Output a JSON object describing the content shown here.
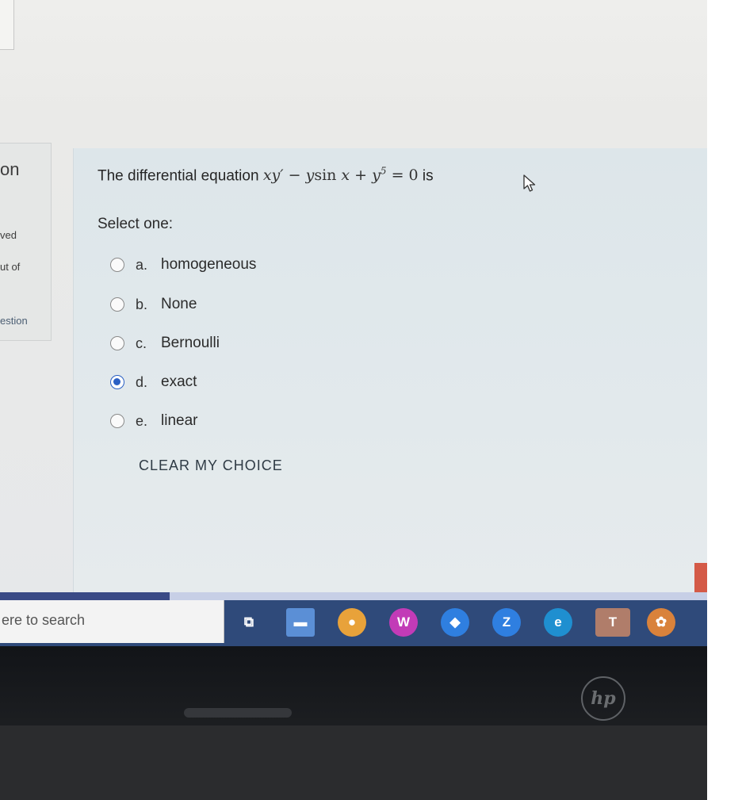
{
  "sidebar": {
    "title": "on",
    "line1": "ved",
    "line2": "ut of",
    "line3": "estion"
  },
  "question": {
    "prefix": "The differential equation",
    "eq": {
      "p1": "xy′ − y",
      "sin": "sin",
      "p2": " x + y",
      "exp": "5",
      "p3": " = 0",
      "suffix": " is"
    },
    "select_label": "Select one:",
    "options": [
      {
        "letter": "a.",
        "text": "homogeneous",
        "selected": false
      },
      {
        "letter": "b.",
        "text": "None",
        "selected": false
      },
      {
        "letter": "c.",
        "text": "Bernoulli",
        "selected": false
      },
      {
        "letter": "d.",
        "text": "exact",
        "selected": true
      },
      {
        "letter": "e.",
        "text": "linear",
        "selected": false
      }
    ],
    "clear_label": "CLEAR MY CHOICE"
  },
  "taskbar": {
    "search_text": "ere to search",
    "icons": [
      {
        "name": "task-view-icon",
        "glyph": "⧉",
        "color": "#2f4a7a"
      },
      {
        "name": "file-explorer-icon",
        "glyph": "▬",
        "color": "#5b8fd6"
      },
      {
        "name": "chrome-icon",
        "glyph": "●",
        "color": "#e8a23a"
      },
      {
        "name": "w-app-icon",
        "glyph": "W",
        "color": "#c23bb7"
      },
      {
        "name": "navigation-app-icon",
        "glyph": "◆",
        "color": "#2f7fe0"
      },
      {
        "name": "z-app-icon",
        "glyph": "Z",
        "color": "#2f7fe0"
      },
      {
        "name": "edge-icon",
        "glyph": "e",
        "color": "#1f8fd0"
      },
      {
        "name": "teams-icon",
        "glyph": "T",
        "color": "#6a6fd0"
      },
      {
        "name": "bird-app-icon",
        "glyph": "✿",
        "color": "#d9823b"
      }
    ],
    "progress_fraction": 0.24
  },
  "hardware": {
    "logo": "hp"
  }
}
